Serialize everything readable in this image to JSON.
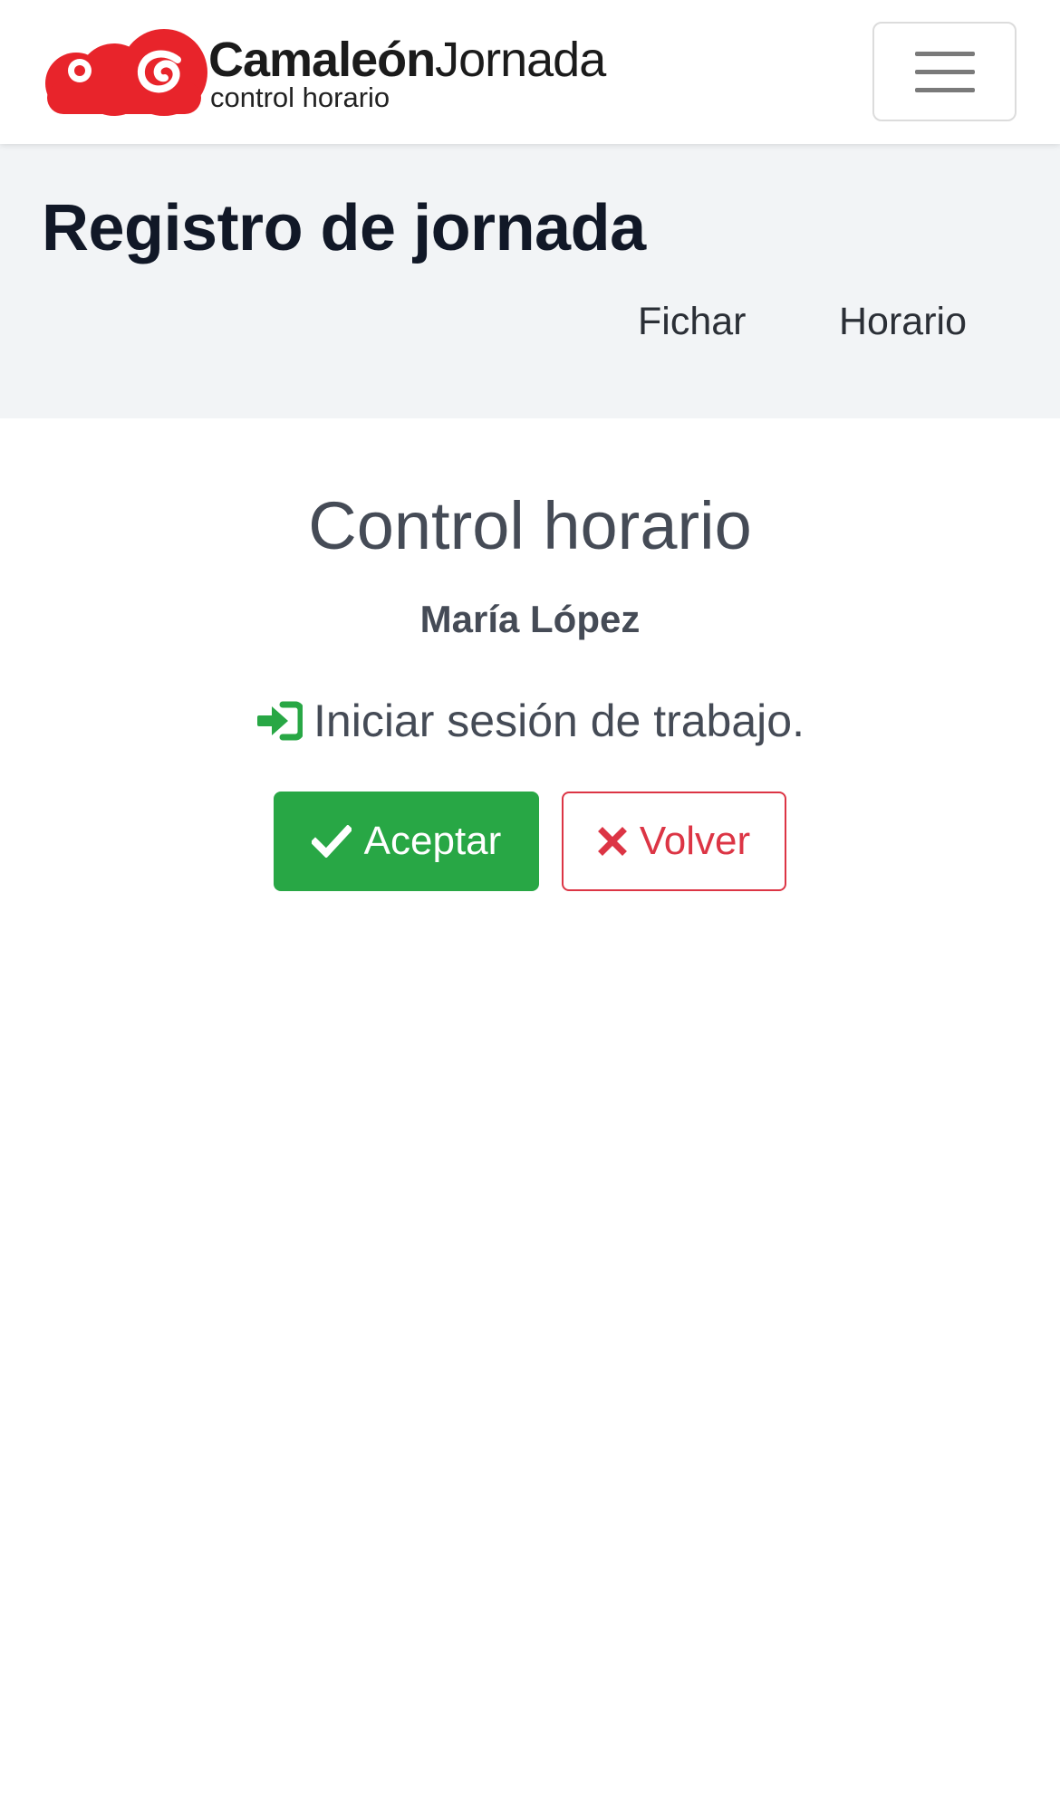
{
  "navbar": {
    "brand_strong": "Camaleón",
    "brand_light": "Jornada",
    "brand_subtitle": "control horario",
    "menu_icon": "hamburger-menu-icon",
    "logo_color": "#e8242b"
  },
  "header": {
    "title": "Registro de jornada",
    "links": [
      {
        "label": "Fichar"
      },
      {
        "label": "Horario"
      }
    ]
  },
  "main": {
    "title": "Control horario",
    "employee_name": "María López",
    "action_icon": "sign-in-icon",
    "action_text": "Iniciar sesión de trabajo.",
    "accept_icon": "check-icon",
    "accept_label": "Aceptar",
    "back_icon": "x-icon",
    "back_label": "Volver"
  },
  "colors": {
    "success": "#28a745",
    "danger": "#dc3545",
    "header_band": "#f2f4f6",
    "text_muted": "#454b56"
  }
}
